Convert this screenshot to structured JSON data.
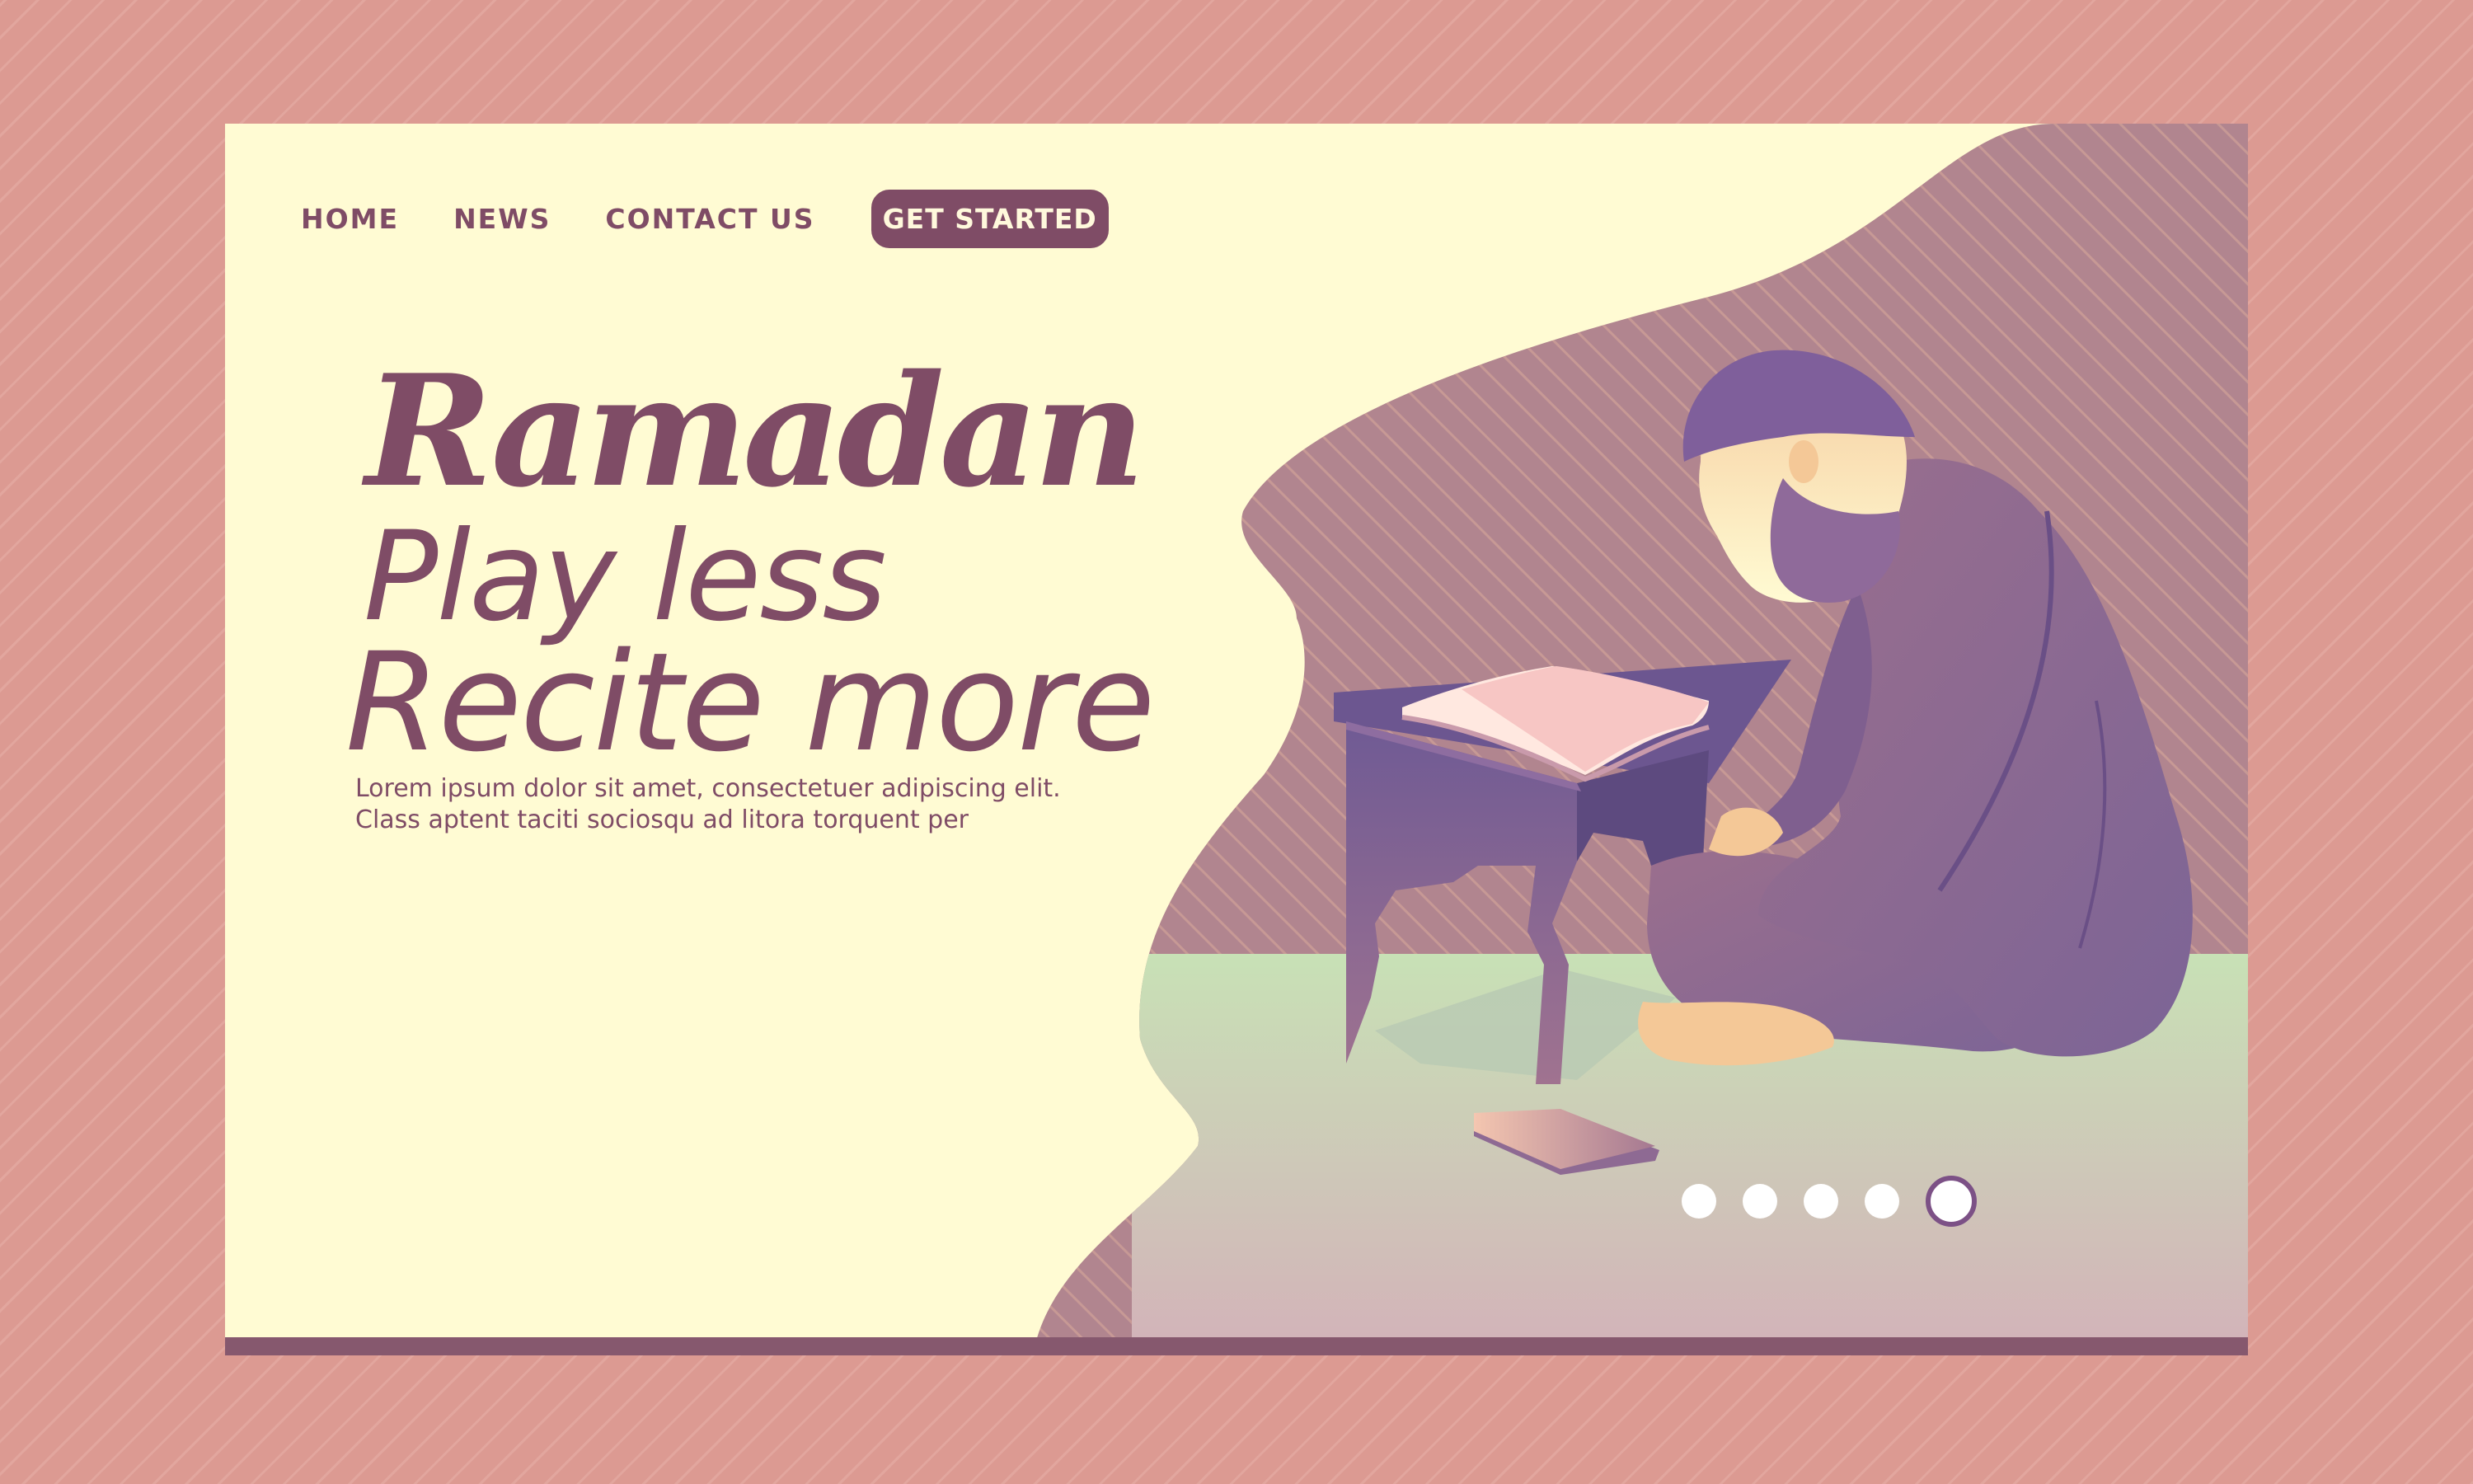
{
  "nav": {
    "links": [
      "HOME",
      "NEWS",
      "CONTACT US"
    ],
    "cta": "GET STARTED"
  },
  "hero": {
    "title": "Ramadan",
    "line1": "Play less",
    "line2": "Recite more",
    "description": "Lorem ipsum dolor sit amet, consectetuer adipiscing elit. Class aptent taciti sociosqu ad litora torquent per"
  },
  "carousel": {
    "slide_count": 5,
    "active_slide": 5
  },
  "colors": {
    "background": "#dc9a92",
    "card": "#fffbd3",
    "accent": "#7f4c66",
    "robe": "#8f6a91",
    "floor": "#d6efbd"
  }
}
